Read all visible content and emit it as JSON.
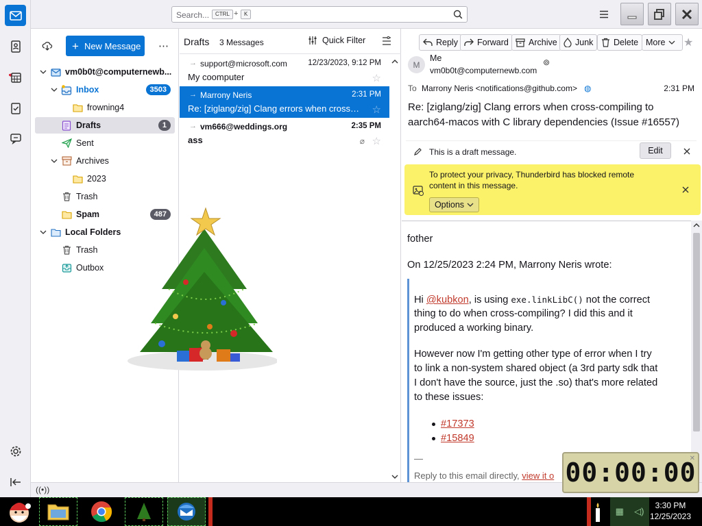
{
  "search": {
    "placeholder": "Search...",
    "key1": "CTRL",
    "plus": "+",
    "key2": "K"
  },
  "new_message": {
    "label": "New Message"
  },
  "folders": {
    "account": "vm0b0t@computernewb...",
    "inbox": {
      "label": "Inbox",
      "count": "3503"
    },
    "frowning4": "frowning4",
    "drafts": {
      "label": "Drafts",
      "count": "1"
    },
    "sent": "Sent",
    "archives": "Archives",
    "year": "2023",
    "trash": "Trash",
    "spam": {
      "label": "Spam",
      "count": "487"
    },
    "local": "Local Folders",
    "local_trash": "Trash",
    "outbox": "Outbox"
  },
  "list": {
    "title": "Drafts",
    "count": "3 Messages",
    "quick_filter": "Quick Filter",
    "messages": [
      {
        "from": "support@microsoft.com",
        "date": "12/23/2023, 9:12 PM",
        "subject": "My coomputer"
      },
      {
        "from": "Marrony Neris",
        "date": "2:31 PM",
        "subject": "Re: [ziglang/zig] Clang errors when cross-..."
      },
      {
        "from": "vm666@weddings.org",
        "date": "2:35 PM",
        "subject": "ass"
      }
    ]
  },
  "reader": {
    "buttons": {
      "reply": "Reply",
      "forward": "Forward",
      "archive": "Archive",
      "junk": "Junk",
      "delete": "Delete",
      "more": "More"
    },
    "from_name": "Me",
    "from_email": "vm0b0t@computernewb.com",
    "avatar_letter": "M",
    "to_label": "To",
    "to_value": "Marrony Neris <notifications@github.com>",
    "time": "2:31 PM",
    "subject_line1": "Re: [ziglang/zig] Clang errors when cross-compiling to",
    "subject_line2": "aarch64-macos with C library dependencies (Issue #16557)",
    "draft_notice": "This is a draft message.",
    "edit": "Edit",
    "privacy_line1": "To protect your privacy, Thunderbird has blocked remote",
    "privacy_line2": "content in this message.",
    "options": "Options",
    "body": {
      "greeting": "fother",
      "wrote": "On 12/25/2023 2:24 PM, Marrony Neris wrote:",
      "p1_hi": "Hi ",
      "p1_mention": "@kubkon",
      "p1_mid": ", is using ",
      "p1_code": "exe.linkLibC()",
      "p1_end": " not the correct",
      "p1_l2": "thing to do when cross-compiling? I did this and it",
      "p1_l3": "produced a working binary.",
      "p2_l1": "However now I'm getting other type of error when I try",
      "p2_l2": "to link a non-system shared object (a 3rd party sdk that",
      "p2_l3": "I don't have the source, just the .so) that's more related",
      "p2_l4": "to these issues:",
      "issue1": "#17373",
      "issue2": "#15849",
      "dash": "—",
      "reply_text": "Reply to this email directly, ",
      "reply_link": "view it o"
    }
  },
  "timer": "00:00:00",
  "taskbar": {
    "time": "3:30 PM",
    "date": "12/25/2023"
  },
  "colors": {
    "accent": "#0a74d4",
    "selected_row": "#0a74d4",
    "privacy_bar": "#fbf26a",
    "link": "#c0392b"
  }
}
